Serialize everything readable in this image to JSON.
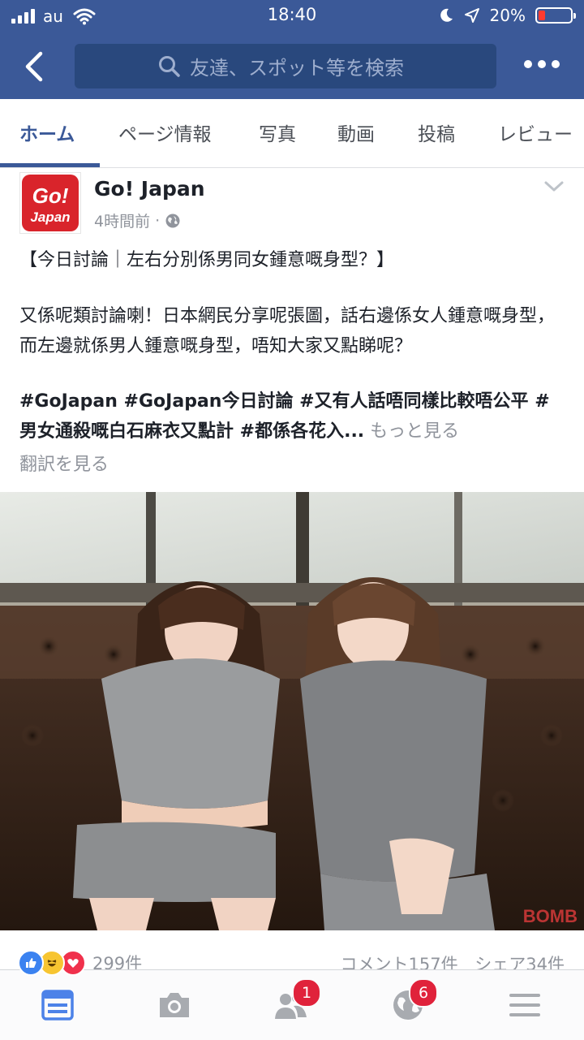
{
  "status_bar": {
    "carrier": "au",
    "time": "18:40",
    "battery_percent": "20%",
    "battery_level": 0.2
  },
  "header": {
    "search_placeholder": "友達、スポット等を検索"
  },
  "tabs": [
    {
      "label": "ホーム",
      "active": true
    },
    {
      "label": "ページ情報",
      "active": false
    },
    {
      "label": "写真",
      "active": false
    },
    {
      "label": "動画",
      "active": false
    },
    {
      "label": "投稿",
      "active": false
    },
    {
      "label": "レビュー",
      "active": false
    }
  ],
  "post": {
    "page_name": "Go! Japan",
    "logo_text": [
      "Go!",
      "Japan"
    ],
    "time": "4時間前",
    "audience_icon": "globe-icon",
    "title_line": "【今日討論｜左右分別係男同女鍾意嘅身型？】",
    "body": "又係呢類討論喇！日本網民分享呢張圖，話右邊係女人鍾意嘅身型，而左邊就係男人鍾意嘅身型，唔知大家又點睇呢？",
    "hashtags": "#GoJapan #GoJapan今日討論 #又有人話唔同樣比較唔公平 #男女通殺嘅白石麻衣又點計 #都係各花入...",
    "see_more": "もっと見る",
    "translate": "翻訳を見る",
    "reactions_count": "299件",
    "comments": "コメント157件",
    "shares": "シェア34件"
  },
  "bottom_nav": {
    "items": [
      {
        "icon": "news-feed-icon",
        "active": true
      },
      {
        "icon": "camera-icon"
      },
      {
        "icon": "friends-icon",
        "badge": "1"
      },
      {
        "icon": "globe-icon",
        "badge": "6"
      },
      {
        "icon": "menu-icon"
      }
    ]
  },
  "colors": {
    "brand": "#3b5998",
    "badge": "#e0223b",
    "battery_low": "#ff3b30"
  }
}
